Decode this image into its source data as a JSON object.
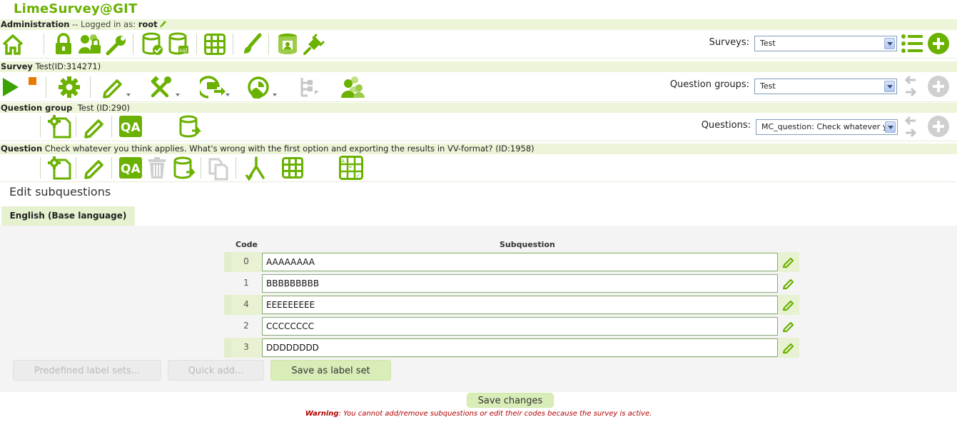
{
  "app": {
    "title": "LimeSurvey@GIT"
  },
  "admin_bar": {
    "label": "Administration",
    "sep": " -- Logged in as: ",
    "user": "root"
  },
  "surveys": {
    "label": "Surveys:",
    "selected": "Test"
  },
  "survey_bar": {
    "label": "Survey",
    "name": "Test(ID:314271)"
  },
  "groups": {
    "label": "Question groups:",
    "selected": "Test"
  },
  "group_bar": {
    "label": "Question group",
    "name": "Test (ID:290)"
  },
  "questions": {
    "label": "Questions:",
    "selected": "MC_question: Check whatever yo"
  },
  "question_bar": {
    "label": "Question",
    "text": "Check whatever you think applies. What's wrong with the first option and exporting the results in VV-format? (ID:1958)"
  },
  "page": {
    "heading": "Edit subquestions",
    "tab": "English (Base language)",
    "columns": {
      "code": "Code",
      "subquestion": "Subquestion"
    },
    "rows": [
      {
        "code": "0",
        "value": "AAAAAAAA"
      },
      {
        "code": "1",
        "value": "BBBBBBBBB"
      },
      {
        "code": "4",
        "value": "EEEEEEEEE"
      },
      {
        "code": "2",
        "value": "CCCCCCCC"
      },
      {
        "code": "3",
        "value": "DDDDDDDD"
      }
    ],
    "buttons": {
      "predefined": "Predefined label sets...",
      "quick_add": "Quick add...",
      "save_label_set": "Save as label set",
      "save_changes": "Save changes"
    },
    "warning": {
      "title": "Warning",
      "text": ": You cannot add/remove subquestions or edit their codes because the survey is active."
    }
  },
  "colors": {
    "accent": "#6ab100",
    "bar_bg": "#ecf5d8",
    "warning": "#b00000"
  }
}
